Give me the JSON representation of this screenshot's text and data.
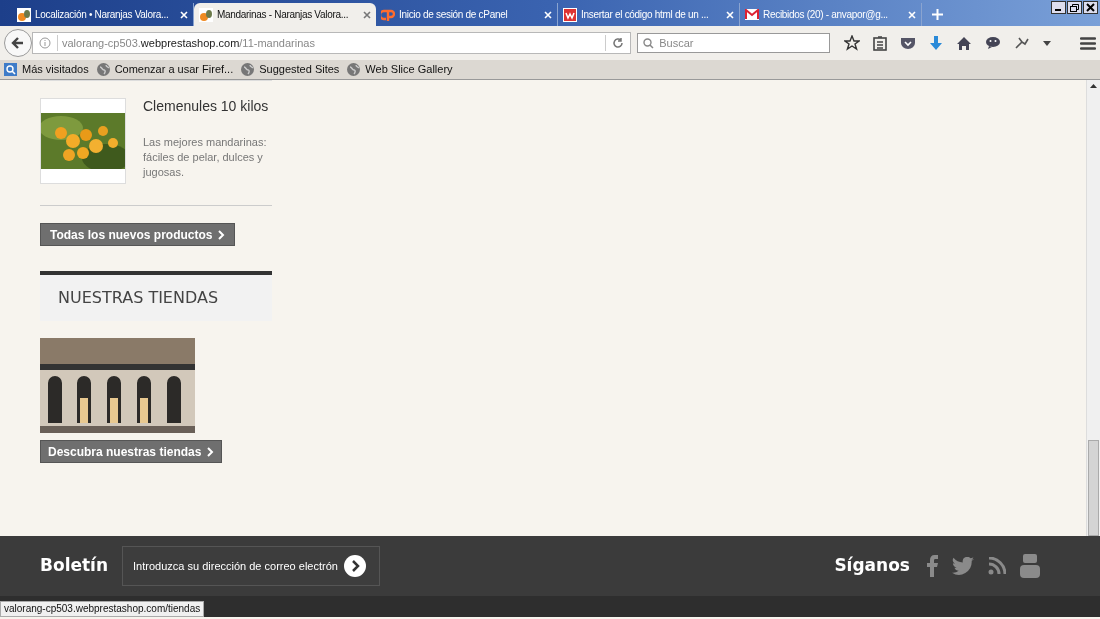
{
  "tabs": [
    {
      "label": "Localización • Naranjas Valora...",
      "selected": false,
      "kind": "fruit"
    },
    {
      "label": "Mandarinas - Naranjas Valora...",
      "selected": true,
      "kind": "fruit"
    },
    {
      "label": "Inicio de sesión de cPanel",
      "selected": false,
      "kind": "panel"
    },
    {
      "label": "Insertar el código html de un ...",
      "selected": false,
      "kind": "site"
    },
    {
      "label": "Recibidos (20) - anvapor@g...",
      "selected": false,
      "kind": "mail"
    }
  ],
  "url": {
    "prefix": "valorang-cp503.",
    "domain": "webprestashop.com",
    "path": "/11-mandarinas"
  },
  "search": {
    "placeholder": "Buscar"
  },
  "bookmarks": [
    {
      "label": "Más visitados",
      "kind": "folder"
    },
    {
      "label": "Comenzar a usar Firef...",
      "kind": "globe"
    },
    {
      "label": "Suggested Sites",
      "kind": "globe"
    },
    {
      "label": "Web Slice Gallery",
      "kind": "globe"
    }
  ],
  "product": {
    "title": "Clemenules 10 kilos",
    "description": "Las mejores mandarinas: fáciles de pelar, dulces y jugosas."
  },
  "all_products_button": "Todas los nuevos productos",
  "stores": {
    "heading": "NUESTRAS TIENDAS",
    "button": "Descubra nuestras tiendas"
  },
  "footer": {
    "newsletter_title": "Boletín",
    "newsletter_placeholder": "Introduzca su dirección de correo electrón",
    "follow_title": "Síganos"
  },
  "status_bar": "valorang-cp503.webprestashop.com/tiendas"
}
